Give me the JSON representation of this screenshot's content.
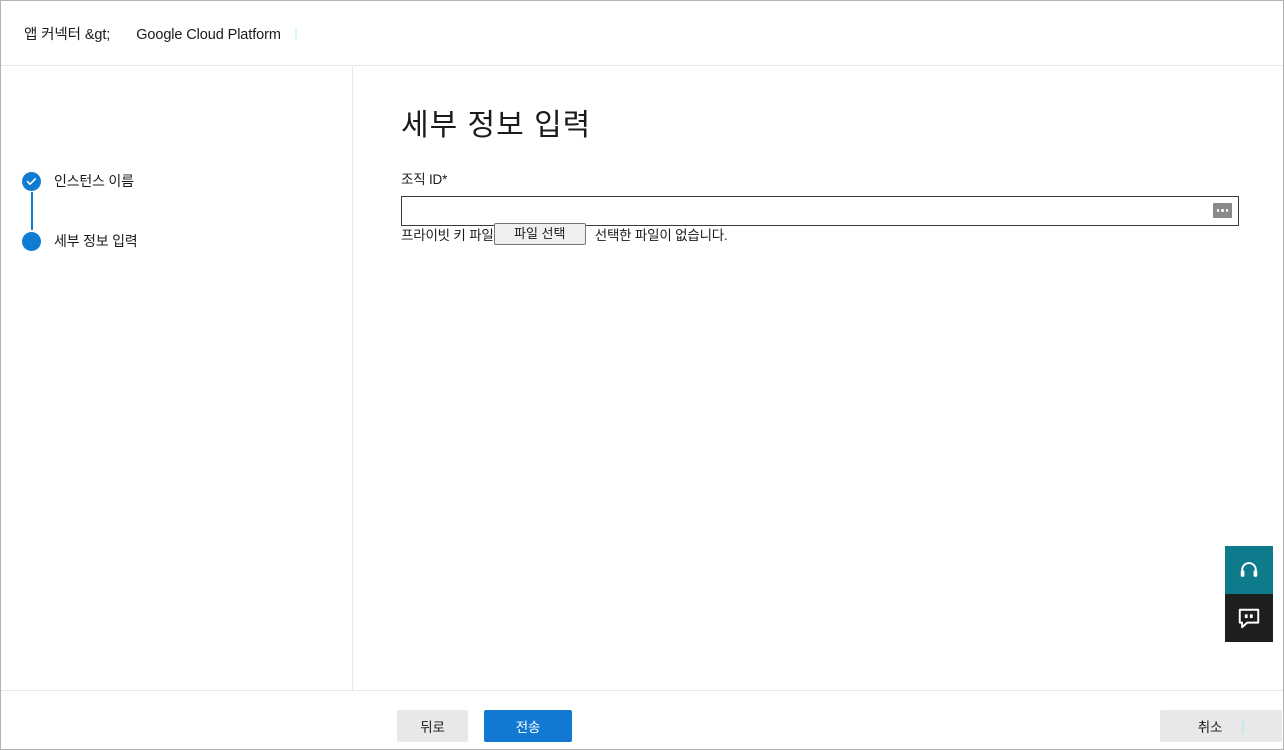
{
  "header": {
    "breadcrumb_app": "앱 커넥터 &gt;",
    "breadcrumb_current": "Google Cloud Platform"
  },
  "wizard": {
    "steps": [
      {
        "label": "인스턴스 이름",
        "state": "completed",
        "icon": "check-circle-icon"
      },
      {
        "label": "세부 정보 입력",
        "state": "current",
        "icon": "filled-circle-icon"
      }
    ]
  },
  "main": {
    "title": "세부 정보 입력",
    "org_field": {
      "label": "조직 ID",
      "required_marker": "*",
      "value": "",
      "placeholder": "",
      "autofill_icon": "autofill-dots-icon"
    },
    "file_field": {
      "label": "프라이빗 키 파일",
      "required_marker": "*",
      "button_label": "파일 선택",
      "status_text": "선택한 파일이 없습니다."
    }
  },
  "widgets": [
    {
      "name": "support",
      "icon": "headset-icon",
      "color": "#0d7b8c"
    },
    {
      "name": "chat",
      "icon": "chat-bubble-icon",
      "color": "#1f1f1f"
    }
  ],
  "footer": {
    "back_label": "뒤로",
    "submit_label": "전송",
    "cancel_label": "취소"
  },
  "colors": {
    "accent_blue": "#1179d1",
    "step_blue": "#0f7cd3",
    "support_teal": "#0d7b8c",
    "chat_black": "#1f1f1f",
    "button_grey": "#e8e8e8",
    "border_grey": "#e6e6e6"
  }
}
